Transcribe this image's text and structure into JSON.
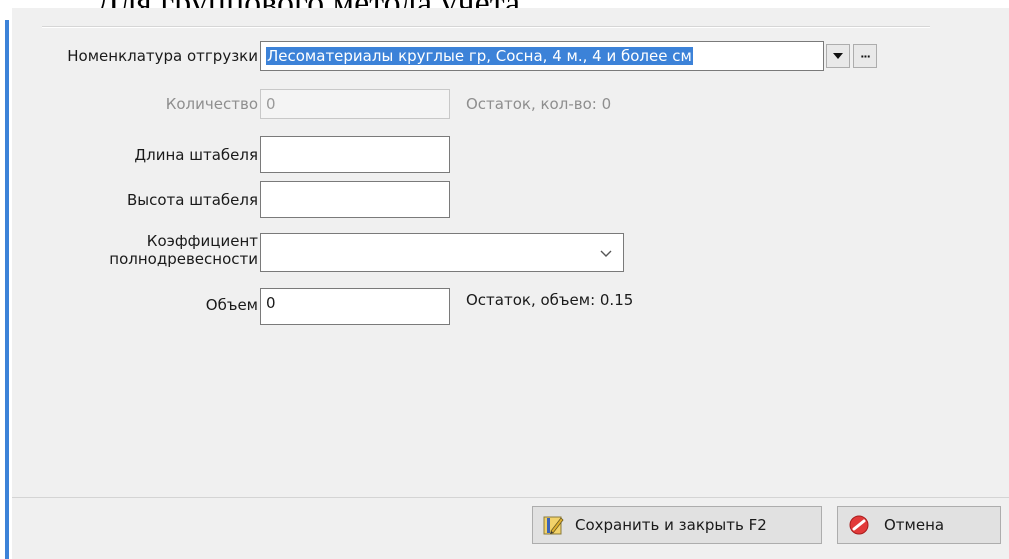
{
  "document": {
    "heading": "Для группового метода учета."
  },
  "form": {
    "nomenclature": {
      "label": "Номенклатура отгрузки",
      "value": "Лесоматериалы круглые гр, Сосна, 4 м., 4 и более см"
    },
    "quantity": {
      "label": "Количество",
      "value": "0",
      "note": "Остаток, кол-во: 0"
    },
    "stack_length": {
      "label": "Длина штабеля",
      "value": ""
    },
    "stack_height": {
      "label": "Высота штабеля",
      "value": ""
    },
    "coefficient": {
      "label_line1": "Коэффициент",
      "label_line2": "полнодревесности",
      "value": ""
    },
    "volume": {
      "label": "Объем",
      "value": "0",
      "note": "Остаток, объем: 0.15"
    }
  },
  "buttons": {
    "save": "Сохранить и закрыть F2",
    "cancel": "Отмена",
    "ellipsis": "···"
  },
  "colors": {
    "selection": "#3c82d8",
    "dialog_bg": "#f0f0f0"
  },
  "icons": {
    "dropdown": "triangle-down-icon",
    "chevron": "chevron-down-icon",
    "save": "save-pencil-icon",
    "cancel": "cancel-red-icon"
  }
}
